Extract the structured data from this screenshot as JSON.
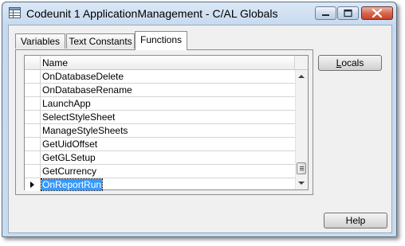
{
  "window": {
    "title": "Codeunit 1 ApplicationManagement - C/AL Globals",
    "icon": "table-icon",
    "controls": [
      "minimize-icon",
      "maximize-icon",
      "close-icon"
    ]
  },
  "tabs": [
    {
      "label": "Variables",
      "active": false
    },
    {
      "label": "Text Constants",
      "active": false
    },
    {
      "label": "Functions",
      "active": true
    }
  ],
  "grid": {
    "columns": [
      "Name"
    ],
    "rows": [
      {
        "name": "OnDatabaseDelete"
      },
      {
        "name": "OnDatabaseRename"
      },
      {
        "name": "LaunchApp"
      },
      {
        "name": "SelectStyleSheet"
      },
      {
        "name": "ManageStyleSheets"
      },
      {
        "name": "GetUidOffset"
      },
      {
        "name": "GetGLSetup"
      },
      {
        "name": "GetCurrency"
      },
      {
        "name": "OnReportRun",
        "selected": true
      }
    ]
  },
  "buttons": {
    "locals": {
      "label_first": "L",
      "label_rest": "ocals"
    },
    "help": {
      "label": "Help"
    }
  },
  "colors": {
    "selection": "#3399ff",
    "titlebar": "#c6d9ef",
    "close_button": "#d8674e"
  }
}
